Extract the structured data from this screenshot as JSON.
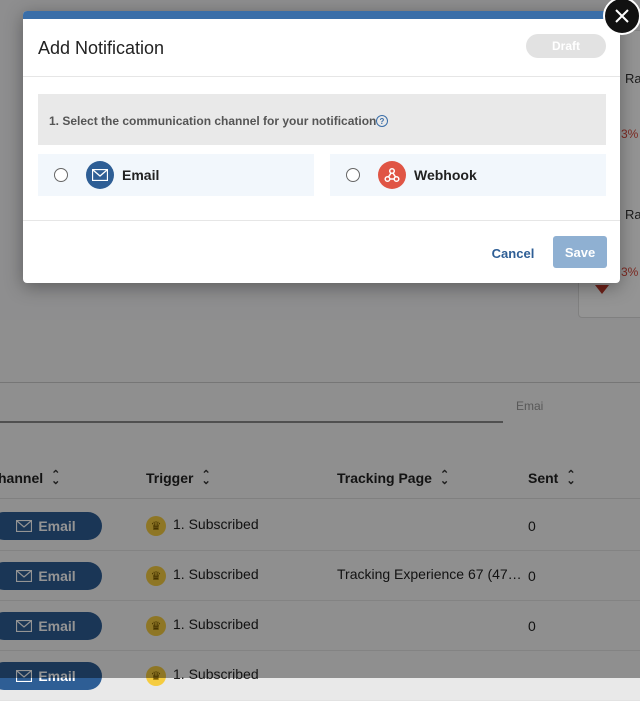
{
  "modal": {
    "title": "Add Notification",
    "badge": "Draft",
    "step_text": "1. Select the communication channel for your notification",
    "help_icon": "help-circle-icon",
    "options": [
      {
        "label": "Email",
        "icon": "envelope-icon",
        "color": "#2e5e95"
      },
      {
        "label": "Webhook",
        "icon": "webhook-icon",
        "color": "#e05545"
      }
    ],
    "cancel_label": "Cancel",
    "save_label": "Save",
    "close_icon": "close-icon"
  },
  "background": {
    "stat_labels": [
      "Ra",
      "Ra"
    ],
    "stat_values": [
      "3%",
      "3%"
    ],
    "search_placeholder": "Emai",
    "columns": [
      "hannel",
      "Trigger",
      "Tracking Page",
      "Sent"
    ],
    "rows": [
      {
        "channel": "Email",
        "trigger": "1. Subscribed",
        "tracking_page": "",
        "sent": "0"
      },
      {
        "channel": "Email",
        "trigger": "1. Subscribed",
        "tracking_page": "Tracking Experience 67 (47…",
        "sent": "0"
      },
      {
        "channel": "Email",
        "trigger": "1. Subscribed",
        "tracking_page": "",
        "sent": "0"
      },
      {
        "channel": "Email",
        "trigger": "1. Subscribed",
        "tracking_page": "",
        "sent": ""
      }
    ]
  },
  "colors": {
    "primary": "#2e5e95",
    "accent_bar": "#3a6ea8",
    "save_disabled": "#8fb0d2",
    "webhook": "#e05545",
    "crown": "#f5cc40"
  }
}
